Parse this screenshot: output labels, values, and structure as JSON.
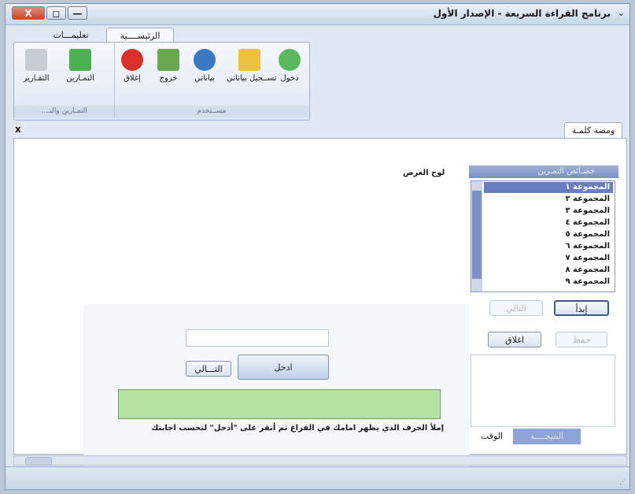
{
  "window": {
    "title": "برنامج القراءة السريعة - الإصدار الأول",
    "close_glyph": "X",
    "max_glyph": "◻",
    "min_glyph": "—",
    "sysmenu_glyph": "⌄"
  },
  "ribbon": {
    "tabs": [
      "الرئيســــية",
      "تعليمـــات"
    ],
    "groups": {
      "user_label": "مســتخدم",
      "tools_label": "...التمـارين والنـ"
    },
    "buttons": [
      {
        "label": "دخول",
        "icon": "enter-icon",
        "color": "#5cb85c"
      },
      {
        "label": "تســجيل بياناتي",
        "icon": "edit-icon",
        "color": "#f0c040"
      },
      {
        "label": "بياناتي",
        "icon": "user-icon",
        "color": "#3a78c0"
      },
      {
        "label": "خروج",
        "icon": "exit-icon",
        "color": "#6aa84f"
      },
      {
        "label": "إغلاق",
        "icon": "stop-icon",
        "color": "#d9302a"
      },
      {
        "label": "التمـارين",
        "icon": "exercise-icon",
        "color": "#4caf50"
      },
      {
        "label": "التقـارير",
        "icon": "report-icon",
        "color": "#c8ced8"
      }
    ]
  },
  "document": {
    "tab_label": "ومضة كلمـة",
    "close_glyph": "x"
  },
  "main": {
    "board_label": "لوح العرض",
    "panel_title": "خصـائص التمـرين",
    "groups": [
      "المجموعة ١",
      "المجموعة ٢",
      "المجموعة ٣",
      "المجموعة ٤",
      "المجموعة ٥",
      "المجموعة ٦",
      "المجموعة ٧",
      "المجموعة ٨",
      "المجموعة ٩"
    ],
    "selected_group": "المجموعة ١",
    "buttons": {
      "start": "إبدأ",
      "next_disabled": "التالي",
      "close": "اغلاق",
      "save_disabled": "حفظ",
      "enter": "ادخل",
      "next": "التـــالي"
    },
    "bottom_tabs": {
      "result": "النتيجــــة",
      "time": "الوقت"
    },
    "entry_value": "",
    "instruction": "إملأ الحرف الذي يظهر امامك في الفراغ ثم أنقر على \"أدخل\" لتحسب اجابتك",
    "status_color": "#b6e3a0"
  }
}
